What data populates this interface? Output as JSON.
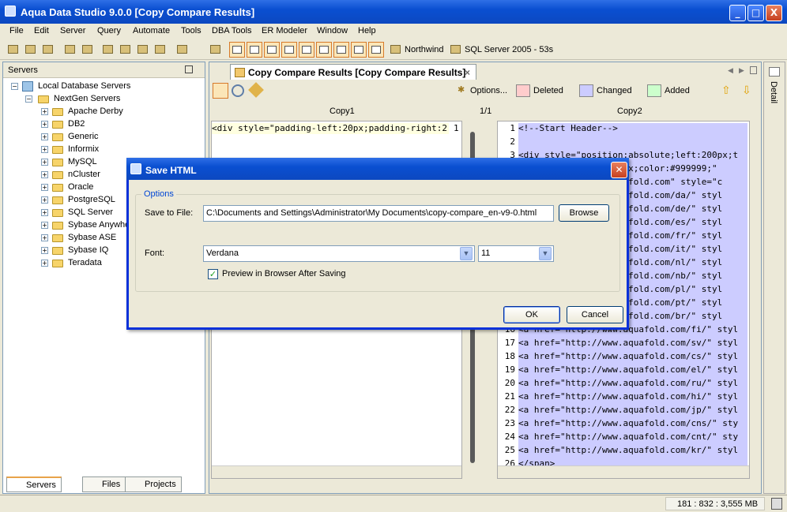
{
  "window": {
    "title": "Aqua Data Studio 9.0.0 [Copy Compare Results]",
    "min": "_",
    "max": "□",
    "close": "X"
  },
  "menu": [
    "File",
    "Edit",
    "Server",
    "Query",
    "Automate",
    "Tools",
    "DBA Tools",
    "ER Modeler",
    "Window",
    "Help"
  ],
  "toolbar": {
    "server1": "Northwind",
    "server2": "SQL Server 2005 - 53s"
  },
  "servers": {
    "header": "Servers",
    "root": "Local Database Servers",
    "group": "NextGen Servers",
    "items": [
      "Apache Derby",
      "DB2",
      "Generic",
      "Informix",
      "MySQL",
      "nCluster",
      "Oracle",
      "PostgreSQL",
      "SQL Server",
      "Sybase Anywhe",
      "Sybase ASE",
      "Sybase IQ",
      "Teradata"
    ],
    "tabs": [
      "Servers",
      "Files",
      "Projects"
    ]
  },
  "compare": {
    "tab_title": "Copy Compare Results [Copy Compare Results]",
    "options": "Options...",
    "legend": [
      {
        "label": "Deleted",
        "color": "#ffcccc"
      },
      {
        "label": "Changed",
        "color": "#ccccff"
      },
      {
        "label": "Added",
        "color": "#ccffcc"
      }
    ],
    "col1": "Copy1",
    "col2": "Copy2",
    "page": "1/1",
    "left_line": "<div style=\"padding-left:20px;padding-right:2",
    "left_line_no": "1",
    "right_lines": [
      "<!--Start Header-->",
      "",
      "<div style=\"position:absolute;left:200px;t",
      "                 e:9px;color:#999999;\"",
      "                 aquafold.com\" style=\"c",
      "                 aquafold.com/da/\" styl",
      "                 aquafold.com/de/\" styl",
      "                 aquafold.com/es/\" styl",
      "                 aquafold.com/fr/\" styl",
      "                 aquafold.com/it/\" styl",
      "                 aquafold.com/nl/\" styl",
      "                 aquafold.com/nb/\" styl",
      "                 aquafold.com/pl/\" styl",
      "                 aquafold.com/pt/\" styl",
      "                 aquafold.com/br/\" styl",
      "<a href=\"http://www.aquafold.com/fi/\" styl",
      "<a href=\"http://www.aquafold.com/sv/\" styl",
      "<a href=\"http://www.aquafold.com/cs/\" styl",
      "<a href=\"http://www.aquafold.com/el/\" styl",
      "<a href=\"http://www.aquafold.com/ru/\" styl",
      "<a href=\"http://www.aquafold.com/hi/\" styl",
      "<a href=\"http://www.aquafold.com/jp/\" styl",
      "<a href=\"http://www.aquafold.com/cns/\" sty",
      "<a href=\"http://www.aquafold.com/cnt/\" sty",
      "<a href=\"http://www.aquafold.com/kr/\" styl",
      "</span>"
    ],
    "side_label": "Detail"
  },
  "dialog": {
    "title": "Save HTML",
    "group": "Options",
    "save_label": "Save to File:",
    "save_value": "C:\\Documents and Settings\\Administrator\\My Documents\\copy-compare_en-v9-0.html",
    "browse": "Browse",
    "font_label": "Font:",
    "font_value": "Verdana",
    "size_value": "11",
    "preview_label": "Preview in Browser After Saving",
    "ok": "OK",
    "cancel": "Cancel"
  },
  "status": {
    "memory": "181 : 832 : 3,555 MB"
  }
}
